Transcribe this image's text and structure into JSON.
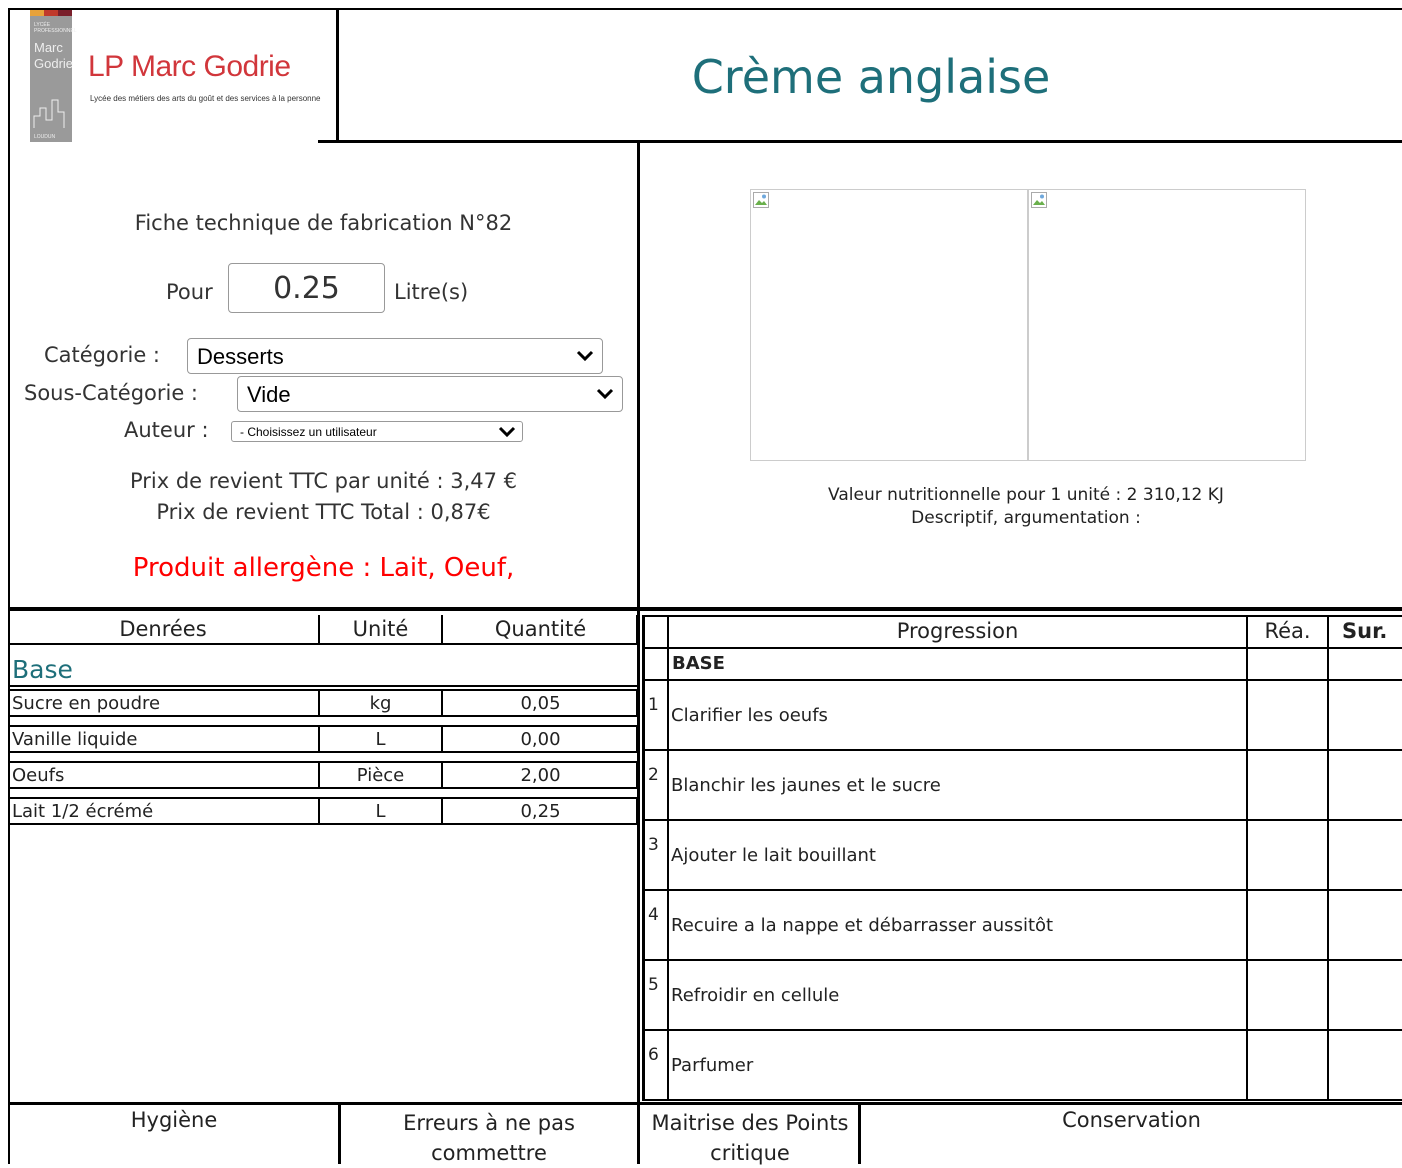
{
  "header": {
    "logo_brand": "LP Marc Godrie",
    "logo_tagline": "Lycée des métiers des arts du goût et des services à la personne",
    "logo_strip_lines": [
      "LYCÉE",
      "PROFESSIONNEL",
      "Marc",
      "Godrie",
      "LOUDUN"
    ],
    "title": "Crème anglaise"
  },
  "info": {
    "fiche_label": "Fiche technique de fabrication N°82",
    "pour_label": "Pour",
    "quantity_value": "0.25",
    "unit_label": "Litre(s)",
    "categorie_label": "Catégorie :",
    "categorie_value": "Desserts",
    "sous_categorie_label": "Sous-Catégorie :",
    "sous_categorie_value": "Vide",
    "auteur_label": "Auteur :",
    "auteur_value": "- Choisissez un utilisateur",
    "prix_unite": "Prix de revient TTC par unité : 3,47 €",
    "prix_total": "Prix de revient TTC Total : 0,87€",
    "allergenes": "Produit allergène : Lait, Oeuf,"
  },
  "nutrition": {
    "valeur": "Valeur nutritionnelle pour 1 unité : 2 310,12 KJ",
    "descriptif": "Descriptif, argumentation :"
  },
  "ingredients": {
    "headers": [
      "Denrées",
      "Unité",
      "Quantité"
    ],
    "section": "Base",
    "rows": [
      {
        "name": "Sucre en poudre",
        "unit": "kg",
        "qty": "0,05"
      },
      {
        "name": "Vanille liquide",
        "unit": "L",
        "qty": "0,00"
      },
      {
        "name": "Oeufs",
        "unit": "Pièce",
        "qty": "2,00"
      },
      {
        "name": "Lait 1/2 écrémé",
        "unit": "L",
        "qty": "0,25"
      }
    ]
  },
  "progression": {
    "headers": [
      "Progression",
      "Réa.",
      "Sur."
    ],
    "section": "BASE",
    "steps": [
      {
        "num": "1",
        "text": "Clarifier les oeufs"
      },
      {
        "num": "2",
        "text": "Blanchir les jaunes et le sucre"
      },
      {
        "num": "3",
        "text": "Ajouter le lait bouillant"
      },
      {
        "num": "4",
        "text": "Recuire a la nappe et débarrasser aussitôt"
      },
      {
        "num": "5",
        "text": "Refroidir en cellule"
      },
      {
        "num": "6",
        "text": "Parfumer"
      }
    ]
  },
  "footer": {
    "hygiene": "Hygiène",
    "erreurs": "Erreurs à ne pas commettre",
    "maitrise": "Maitrise des Points critique",
    "conservation": "Conservation"
  },
  "colors": {
    "title": "#1e6f7a",
    "section": "#1e6f7a",
    "allergen": "#ff0000",
    "logo_red": "#d1363b"
  }
}
